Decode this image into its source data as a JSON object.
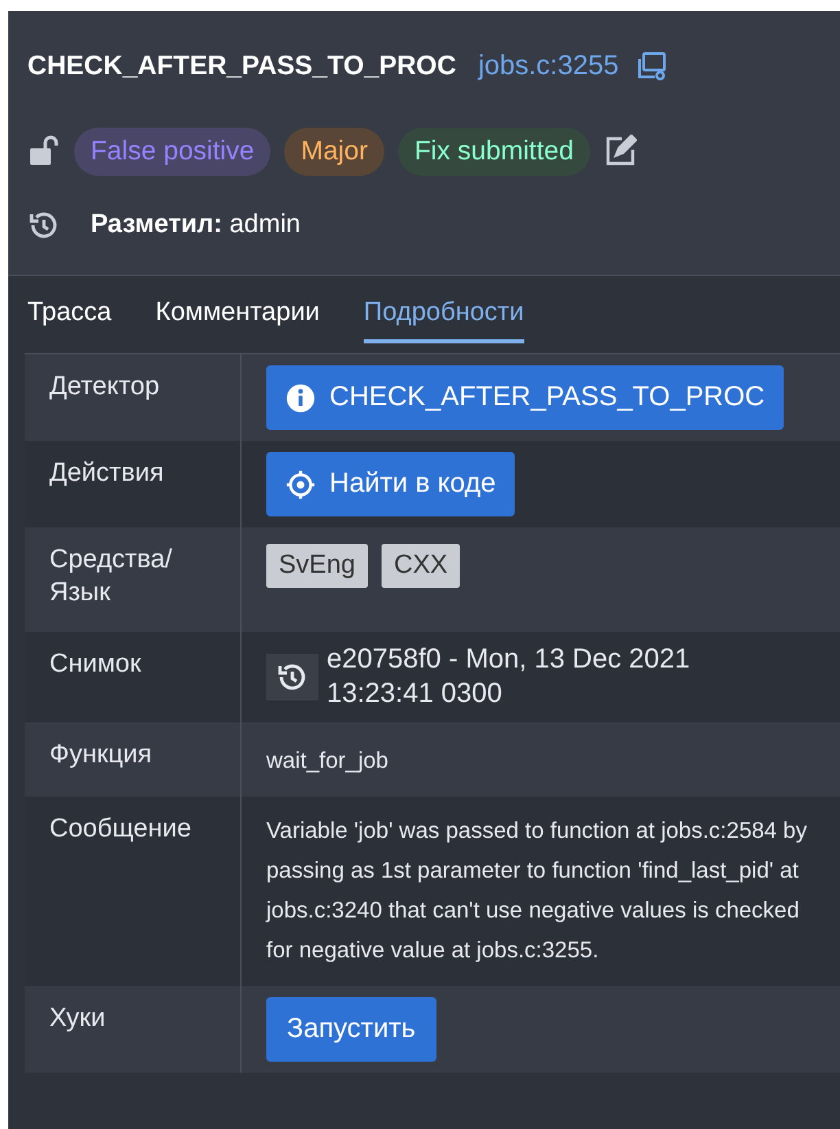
{
  "header": {
    "title": "CHECK_AFTER_PASS_TO_PROC",
    "location_link": "jobs.c:3255",
    "locked": false,
    "badges": [
      {
        "label": "False positive",
        "color": "#4a4668"
      },
      {
        "label": "Major",
        "color": "#5a4636"
      },
      {
        "label": "Fix submitted",
        "color": "#35493f"
      }
    ],
    "marked_by_label": "Разметил:",
    "marked_by": "admin"
  },
  "tabs": [
    {
      "label": "Трасса",
      "selected": false
    },
    {
      "label": "Комментарии",
      "selected": false
    },
    {
      "label": "Подробности",
      "selected": true
    }
  ],
  "details": [
    {
      "label": "Детектор",
      "kind": "info-button",
      "value": "CHECK_AFTER_PASS_TO_PROC"
    },
    {
      "label": "Действия",
      "kind": "locate-button",
      "value": "Найти в коде"
    },
    {
      "label": "Средства/ Язык",
      "kind": "tags",
      "tags": [
        "SvEng",
        "CXX"
      ]
    },
    {
      "label": "Снимок",
      "kind": "snapshot",
      "value": "e20758f0 - Mon, 13 Dec 2021 13:23:41 0300"
    },
    {
      "label": "Функция",
      "kind": "text",
      "value": "wait_for_job"
    },
    {
      "label": "Сообщение",
      "kind": "text",
      "value": "Variable 'job' was passed to function at jobs.c:2584 by passing as 1st parameter to function 'find_last_pid' at jobs.c:3240 that can't use negative values is checked for negative value at jobs.c:3255."
    },
    {
      "label": "Хуки",
      "kind": "button",
      "value": "Запустить"
    }
  ]
}
